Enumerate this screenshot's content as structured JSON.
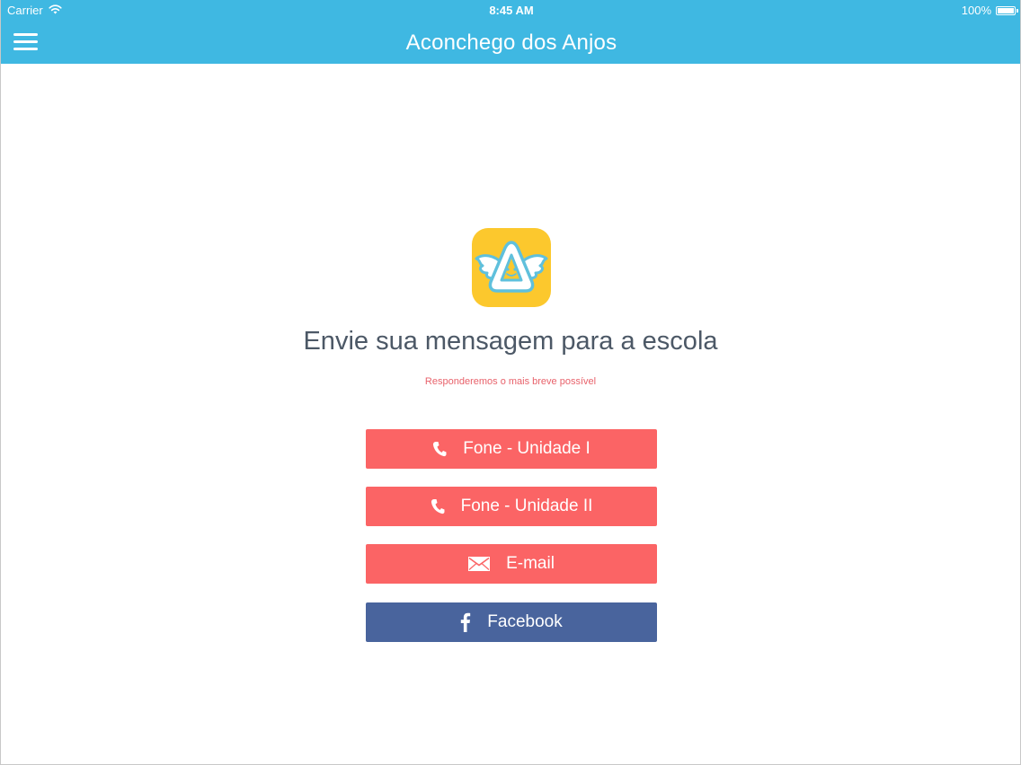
{
  "status_bar": {
    "carrier": "Carrier",
    "time": "8:45 AM",
    "battery_percent": "100%"
  },
  "nav": {
    "title": "Aconchego dos Anjos",
    "menu_icon": "hamburger-menu-icon"
  },
  "content": {
    "logo_icon": "angel-logo-icon",
    "headline": "Envie sua mensagem para a escola",
    "subline": "Responderemos o mais breve possível"
  },
  "buttons": [
    {
      "label": "Fone - Unidade I",
      "icon": "phone-icon",
      "color": "#fb6465"
    },
    {
      "label": "Fone - Unidade II",
      "icon": "phone-icon",
      "color": "#fb6465"
    },
    {
      "label": "E-mail",
      "icon": "mail-icon",
      "color": "#fb6465"
    },
    {
      "label": "Facebook",
      "icon": "facebook-icon",
      "color": "#49649d"
    }
  ],
  "colors": {
    "nav_background": "#3fb8e2",
    "logo_background": "#fcc82d",
    "accent_red": "#fb6465",
    "facebook_blue": "#49649d",
    "headline_text": "#4c5866",
    "subline_text": "#e8626b"
  }
}
